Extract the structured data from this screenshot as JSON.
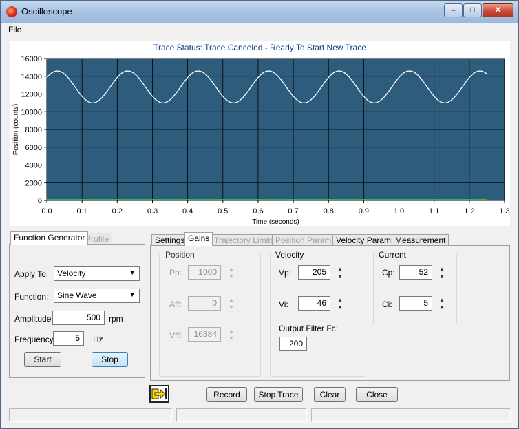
{
  "window": {
    "title": "Oscilloscope",
    "min": "–",
    "max": "□",
    "close": "✕"
  },
  "menu": {
    "file": "File"
  },
  "trace": {
    "status": "Trace Status:  Trace Canceled - Ready To Start New Trace"
  },
  "chart_data": {
    "type": "line",
    "xlabel": "Time (seconds)",
    "ylabel": "Position (counts)",
    "xlim": [
      0.0,
      1.3
    ],
    "ylim": [
      0,
      16000
    ],
    "x_ticks": [
      "0.0",
      "0.1",
      "0.2",
      "0.3",
      "0.4",
      "0.5",
      "0.6",
      "0.7",
      "0.8",
      "0.9",
      "1.0",
      "1.1",
      "1.2",
      "1.3"
    ],
    "y_ticks": [
      "0",
      "2000",
      "4000",
      "6000",
      "8000",
      "10000",
      "12000",
      "14000",
      "16000"
    ],
    "grid": true,
    "background": "#2e5c7c",
    "series": [
      {
        "color": "#ffffff",
        "kind": "sine",
        "center": 12800,
        "amplitude": 1800,
        "frequency_hz": 5,
        "phase_peak_at": 0.03,
        "x_end": 1.25
      },
      {
        "color": "#20c050",
        "kind": "constant",
        "value": 0,
        "x_end": 1.25
      }
    ]
  },
  "left_tabs": [
    "Function Generator",
    "Profile"
  ],
  "fg": {
    "apply_label": "Apply To:",
    "apply_value": "Velocity",
    "function_label": "Function:",
    "function_value": "Sine Wave",
    "amplitude_label": "Amplitude:",
    "amplitude_value": "500",
    "amplitude_unit": "rpm",
    "frequency_label": "Frequency:",
    "frequency_value": "5",
    "frequency_unit": "Hz",
    "start": "Start",
    "stop": "Stop"
  },
  "right_tabs": [
    "Settings",
    "Gains",
    "Trajectory Limits",
    "Position Params",
    "Velocity Params",
    "Measurement"
  ],
  "gains": {
    "position": {
      "title": "Position",
      "pp_label": "Pp:",
      "pp": "1000",
      "aff_label": "Aff:",
      "aff": "0",
      "vff_label": "Vff:",
      "vff": "16384"
    },
    "velocity": {
      "title": "Velocity",
      "vp_label": "Vp:",
      "vp": "205",
      "vi_label": "Vi:",
      "vi": "46",
      "filter_label": "Output Filter Fc:",
      "filter": "200"
    },
    "current": {
      "title": "Current",
      "cp_label": "Cp:",
      "cp": "52",
      "ci_label": "Ci:",
      "ci": "5"
    }
  },
  "actions": {
    "record": "Record",
    "stop_trace": "Stop Trace",
    "clear": "Clear",
    "close": "Close"
  }
}
